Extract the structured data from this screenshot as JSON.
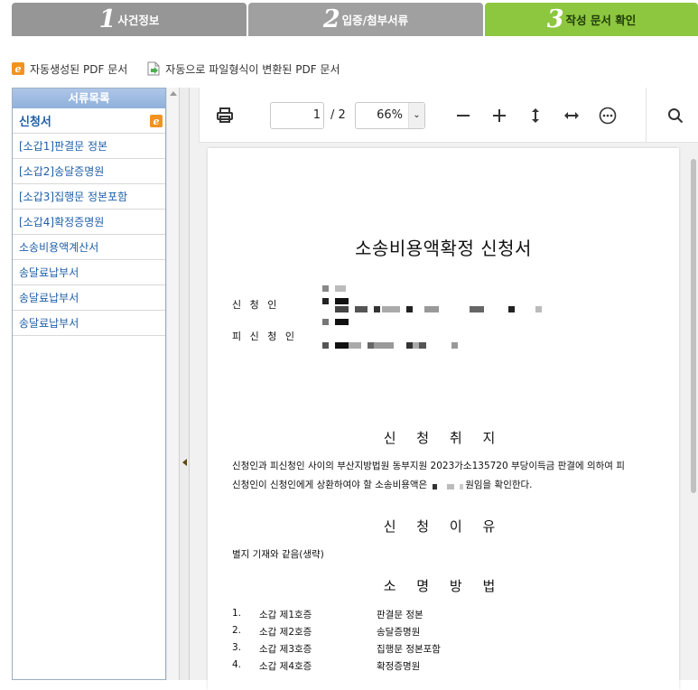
{
  "steps": [
    {
      "num": "1",
      "label": "사건정보"
    },
    {
      "num": "2",
      "label": "입증/첨부서류"
    },
    {
      "num": "3",
      "label": "작성 문서 확인"
    }
  ],
  "legend": {
    "auto_pdf": "자동생성된 PDF 문서",
    "converted_pdf": "자동으로 파일형식이 변환된 PDF 문서"
  },
  "doclist": {
    "title": "서류목록",
    "items": [
      {
        "label": "신청서"
      },
      {
        "label": "[소갑1]판결문 정본"
      },
      {
        "label": "[소갑2]송달증명원"
      },
      {
        "label": "[소갑3]집행문 정본포함"
      },
      {
        "label": "[소갑4]확정증명원"
      },
      {
        "label": "소송비용액계산서"
      },
      {
        "label": "송달료납부서"
      },
      {
        "label": "송달료납부서"
      },
      {
        "label": "송달료납부서"
      }
    ]
  },
  "viewer": {
    "page_current": "1",
    "page_total": "/ 2",
    "zoom": "66%"
  },
  "document": {
    "title": "소송비용액확정  신청서",
    "applicant_label": "신 청 인",
    "respondent_label": "피 신 청 인",
    "purpose_title": "신 청 취 지",
    "purpose_line1": "신청인과 피신청인 사이의 부산지방법원 동부지원 2023가소135720 부당이득금 판결에 의하여 피",
    "purpose_line2a": "신청인이 신청인에게 상환하여야 할 소송비용액은",
    "purpose_line2b": "원임을 확인한다.",
    "reason_title": "신 청 이 유",
    "reason_text": "별지 기재와 같음(생략)",
    "evidence_title": "소 명 방 법",
    "evidence": [
      {
        "no": "1.",
        "code": "소갑 제1호증",
        "name": "판결문 정본"
      },
      {
        "no": "2.",
        "code": "소갑 제2호증",
        "name": "송달증명원"
      },
      {
        "no": "3.",
        "code": "소갑 제3호증",
        "name": "집행문 정본포함"
      },
      {
        "no": "4.",
        "code": "소갑 제4호증",
        "name": "확정증명원"
      }
    ]
  },
  "colors": {
    "step_inactive": "#969696",
    "step_active": "#8dc63f",
    "list_link": "#1f5fa8",
    "ie_icon": "#f19320"
  }
}
